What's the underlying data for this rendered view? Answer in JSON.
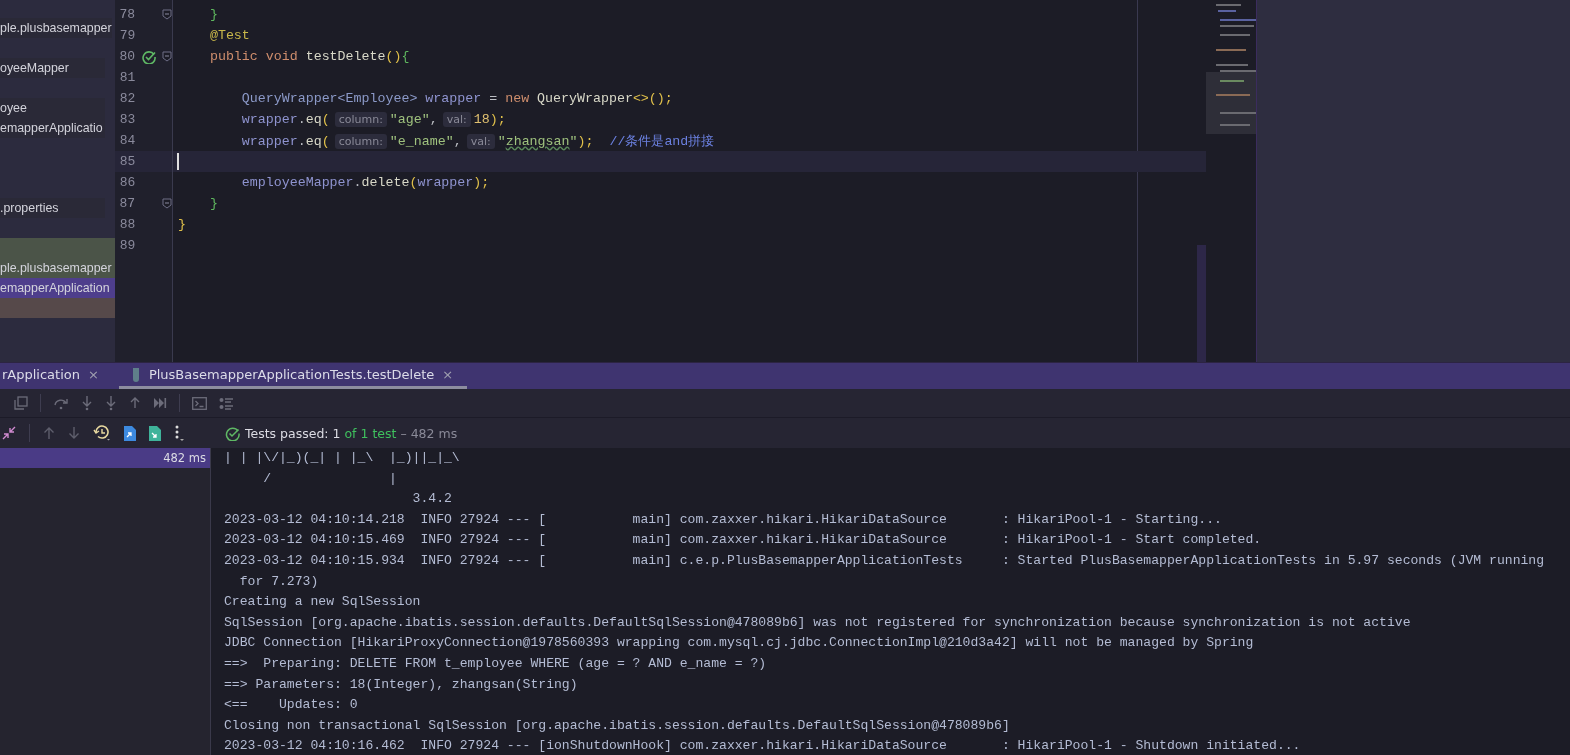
{
  "project_panel": {
    "items": [
      {
        "label": "ple.plusbasemapper",
        "kind": "plain"
      },
      {
        "label": "oyeeMapper",
        "kind": "plain"
      },
      {
        "label": "oyee",
        "kind": "plain"
      },
      {
        "label": "emapperApplicatio",
        "kind": "plain"
      },
      {
        "label": ".properties",
        "kind": "plain"
      },
      {
        "label": "ple.plusbasemapper",
        "kind": "found"
      },
      {
        "label": "emapperApplication",
        "kind": "selected"
      }
    ]
  },
  "editor": {
    "lines": [
      {
        "number": "78",
        "fold": true,
        "tokens": [
          {
            "kind": "b2",
            "text": "    }"
          }
        ]
      },
      {
        "number": "79",
        "tokens": [
          {
            "kind": "annot",
            "text": "    @Test"
          }
        ]
      },
      {
        "number": "80",
        "fold": true,
        "test_passed": true,
        "tokens": [
          {
            "kind": "kw",
            "text": "    public void "
          },
          {
            "kind": "fn",
            "text": "testDelete"
          },
          {
            "kind": "b1",
            "text": "()"
          },
          {
            "kind": "b2",
            "text": "{"
          }
        ]
      },
      {
        "number": "81"
      },
      {
        "number": "82",
        "tokens": [
          {
            "kind": "type",
            "text": "        QueryWrapper<Employee>"
          },
          {
            "kind": "field",
            "text": " wrapper"
          },
          {
            "kind": "plain",
            "text": " = "
          },
          {
            "kind": "kw",
            "text": "new "
          },
          {
            "kind": "fn",
            "text": "QueryWrapper"
          },
          {
            "kind": "b1",
            "text": "<>();"
          }
        ]
      },
      {
        "number": "83",
        "tokens": [
          {
            "kind": "field",
            "text": "        wrapper"
          },
          {
            "kind": "plain",
            "text": "."
          },
          {
            "kind": "fn",
            "text": "eq"
          },
          {
            "kind": "b1",
            "text": "("
          },
          {
            "kind": "hint",
            "text": "column:"
          },
          {
            "kind": "str",
            "text": "\"age\""
          },
          {
            "kind": "plain",
            "text": ","
          },
          {
            "kind": "hint",
            "text": "val:"
          },
          {
            "kind": "num",
            "text": "18"
          },
          {
            "kind": "b1",
            "text": ");"
          }
        ]
      },
      {
        "number": "84",
        "tokens": [
          {
            "kind": "field",
            "text": "        wrapper"
          },
          {
            "kind": "plain",
            "text": "."
          },
          {
            "kind": "fn",
            "text": "eq"
          },
          {
            "kind": "b1",
            "text": "("
          },
          {
            "kind": "hint",
            "text": "column:"
          },
          {
            "kind": "str",
            "text": "\"e_name\""
          },
          {
            "kind": "plain",
            "text": ","
          },
          {
            "kind": "hint",
            "text": "val:"
          },
          {
            "kind": "str",
            "text": "\""
          },
          {
            "kind": "typo",
            "text": "zhangsan"
          },
          {
            "kind": "str",
            "text": "\""
          },
          {
            "kind": "b1",
            "text": ");  "
          },
          {
            "kind": "comment",
            "text": "//条件是and拼接"
          }
        ]
      },
      {
        "number": "85",
        "current": true
      },
      {
        "number": "86",
        "tokens": [
          {
            "kind": "field",
            "text": "        employeeMapper"
          },
          {
            "kind": "plain",
            "text": "."
          },
          {
            "kind": "fn",
            "text": "delete"
          },
          {
            "kind": "b1",
            "text": "("
          },
          {
            "kind": "field",
            "text": "wrapper"
          },
          {
            "kind": "b1",
            "text": ");"
          }
        ]
      },
      {
        "number": "87",
        "fold": true,
        "tokens": [
          {
            "kind": "b2",
            "text": "    }"
          }
        ]
      },
      {
        "number": "88",
        "tokens": [
          {
            "kind": "b1",
            "text": "}"
          }
        ]
      },
      {
        "number": "89"
      }
    ]
  },
  "run_panel": {
    "tabs": [
      {
        "label": "rApplication",
        "close": "×",
        "selected": false
      },
      {
        "label": "PlusBasemapperApplicationTests.testDelete",
        "close": "×",
        "selected": true,
        "kind": "test"
      }
    ],
    "status": {
      "summary": "Tests passed: 1",
      "count": "of 1 test",
      "duration": "– 482 ms"
    },
    "test_tree": [
      {
        "duration": "482 ms",
        "selected": true
      }
    ],
    "console": {
      "lines": [
        "| | |\\/|_)(_| | |_\\  |_)||_|_\\",
        "     /               |",
        "                        3.4.2",
        "2023-03-12 04:10:14.218  INFO 27924 --- [           main] com.zaxxer.hikari.HikariDataSource       : HikariPool-1 - Starting...",
        "2023-03-12 04:10:15.469  INFO 27924 --- [           main] com.zaxxer.hikari.HikariDataSource       : HikariPool-1 - Start completed.",
        "2023-03-12 04:10:15.934  INFO 27924 --- [           main] c.e.p.PlusBasemapperApplicationTests     : Started PlusBasemapperApplicationTests in 5.97 seconds (JVM running",
        "  for 7.273)",
        "Creating a new SqlSession",
        "SqlSession [org.apache.ibatis.session.defaults.DefaultSqlSession@478089b6] was not registered for synchronization because synchronization is not active",
        "JDBC Connection [HikariProxyConnection@1978560393 wrapping com.mysql.cj.jdbc.ConnectionImpl@210d3a42] will not be managed by Spring",
        "==>  Preparing: DELETE FROM t_employee WHERE (age = ? AND e_name = ?)",
        "==> Parameters: 18(Integer), zhangsan(String)",
        "<==    Updates: 0",
        "Closing non transactional SqlSession [org.apache.ibatis.session.defaults.DefaultSqlSession@478089b6]",
        "2023-03-12 04:10:16.462  INFO 27924 --- [ionShutdownHook] com.zaxxer.hikari.HikariDataSource       : HikariPool-1 - Shutdown initiated..."
      ]
    }
  }
}
